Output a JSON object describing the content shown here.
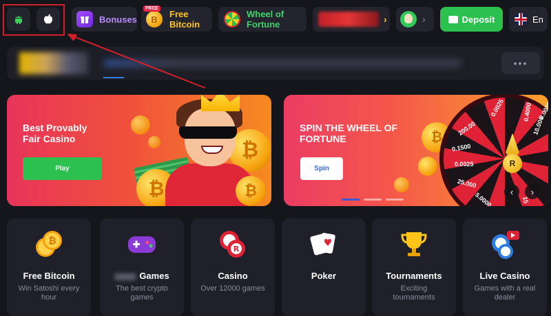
{
  "topbar": {
    "bonuses_label": "Bonuses",
    "free_badge": "FREE",
    "free_bitcoin_label": "Free\nBitcoin",
    "wheel_label": "Wheel of\nFortune",
    "deposit_label": "Deposit",
    "language_label": "En",
    "chevron": "›"
  },
  "nav": {
    "more_label": "•••"
  },
  "banners": [
    {
      "title": "Best Provably\nFair Casino",
      "button": "Play"
    },
    {
      "title": "Spin the Wheel of\nFortune",
      "button": "Spin"
    }
  ],
  "wheel_values": [
    "0.0025",
    "200.00",
    "0.1500",
    "0.0025",
    "25.000",
    "5.0000",
    "0.4000",
    "10.000",
    "0.0025",
    "15"
  ],
  "carousel": {
    "prev": "‹",
    "next": "›"
  },
  "categories": [
    {
      "title": "Free Bitcoin",
      "desc": "Win Satoshi every hour"
    },
    {
      "title": "Games",
      "desc": "The best crypto games"
    },
    {
      "title": "Casino",
      "desc": "Over 12000 games"
    },
    {
      "title": "Poker",
      "desc": ""
    },
    {
      "title": "Tournaments",
      "desc": "Exciting tournaments"
    },
    {
      "title": "Live Casino",
      "desc": "Games with a real dealer"
    }
  ],
  "colors": {
    "background": "#15161c",
    "accent_green": "#2cc14f",
    "annotation_red": "#d3202a",
    "card_bg": "#1f2029"
  },
  "icons": [
    "android-icon",
    "apple-icon",
    "gift-icon",
    "bitcoin-coin-icon",
    "fortune-wheel-icon",
    "avatar",
    "wallet-icon",
    "uk-flag-icon"
  ]
}
